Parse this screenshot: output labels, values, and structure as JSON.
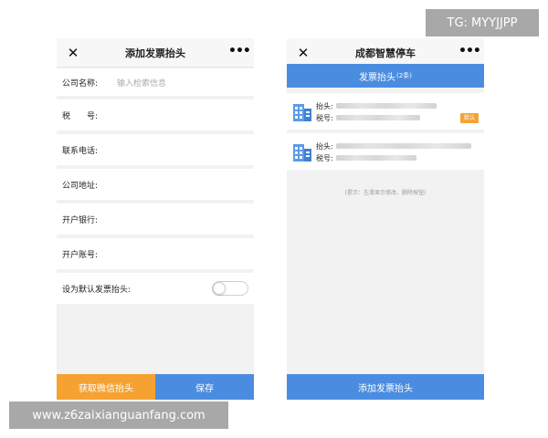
{
  "left": {
    "close_icon": "✕",
    "title": "添加发票抬头",
    "more_icon": "•••",
    "fields": [
      {
        "label": "公司名称:",
        "placeholder": "输入检索信息"
      },
      {
        "label": "税　　号:",
        "placeholder": ""
      },
      {
        "label": "联系电话:",
        "placeholder": ""
      },
      {
        "label": "公司地址:",
        "placeholder": ""
      },
      {
        "label": "开户银行:",
        "placeholder": ""
      },
      {
        "label": "开户账号:",
        "placeholder": ""
      }
    ],
    "default_toggle_label": "设为默认发票抬头:",
    "default_toggle_on": false,
    "wechat_button": "获取微信抬头",
    "save_button": "保存"
  },
  "right": {
    "close_icon": "✕",
    "title": "成都智慧停车",
    "more_icon": "•••",
    "tab_label": "发票抬头",
    "tab_count": "(2条)",
    "items": [
      {
        "header_key": "抬头:",
        "tax_key": "税号:",
        "tag": "默认"
      },
      {
        "header_key": "抬头:",
        "tax_key": "税号:",
        "tag": ""
      }
    ],
    "hint": "(提示：左滑显示修改、删除按钮)",
    "add_button": "添加发票抬头"
  },
  "overlays": {
    "tg_text": "TG: MYYJJPP",
    "url_text": "www.z6zaixianguanfang.com"
  },
  "colors": {
    "accent_blue": "#4a8de0",
    "accent_orange": "#f5a233",
    "page_bg": "#f2f2f2"
  }
}
